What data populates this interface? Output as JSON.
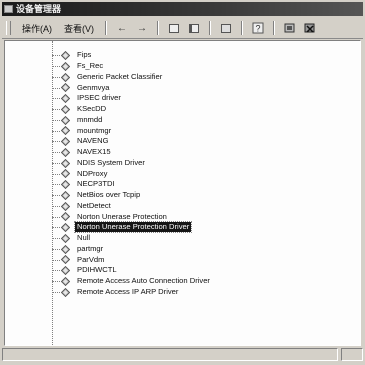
{
  "window": {
    "title": "设备管理器"
  },
  "menubar": {
    "action_label": "操作(A)",
    "view_label": "查看(V)"
  },
  "toolbar": {
    "back_icon": "←",
    "forward_icon": "→"
  },
  "tree": {
    "items": [
      {
        "label": "Fips"
      },
      {
        "label": "Fs_Rec"
      },
      {
        "label": "Generic Packet Classifier"
      },
      {
        "label": "Genmvya"
      },
      {
        "label": "IPSEC driver"
      },
      {
        "label": "KSecDD"
      },
      {
        "label": "mnmdd"
      },
      {
        "label": "mountmgr"
      },
      {
        "label": "NAVENG"
      },
      {
        "label": "NAVEX15"
      },
      {
        "label": "NDIS System Driver"
      },
      {
        "label": "NDProxy"
      },
      {
        "label": "NECP3TDI"
      },
      {
        "label": "NetBios over Tcpip"
      },
      {
        "label": "NetDetect"
      },
      {
        "label": "Norton Unerase Protection"
      },
      {
        "label": "Norton Unerase Protection Driver",
        "selected": true
      },
      {
        "label": "Null"
      },
      {
        "label": "partmgr"
      },
      {
        "label": "ParVdm"
      },
      {
        "label": "PDIHWCTL"
      },
      {
        "label": "Remote Access Auto Connection Driver"
      },
      {
        "label": "Remote Access IP ARP Driver"
      }
    ]
  },
  "colors": {
    "window_bg": "#d4d0c8",
    "content_bg": "#fdfdfd",
    "selection_bg": "#151515",
    "selection_text": "#ffffff"
  }
}
